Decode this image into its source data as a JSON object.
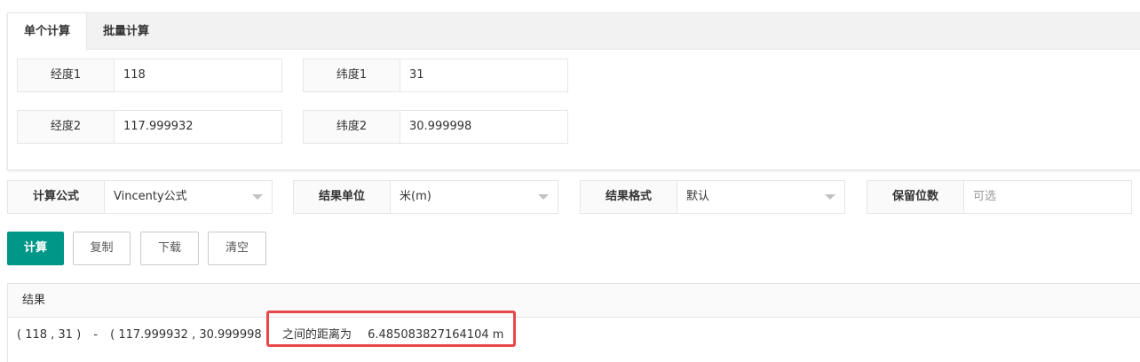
{
  "tabs": [
    "单个计算",
    "批量计算"
  ],
  "inputs": {
    "lon1": {
      "label": "经度1",
      "value": "118"
    },
    "lat1": {
      "label": "纬度1",
      "value": "31"
    },
    "lon2": {
      "label": "经度2",
      "value": "117.999932"
    },
    "lat2": {
      "label": "纬度2",
      "value": "30.999998"
    }
  },
  "options": {
    "formula": {
      "label": "计算公式",
      "value": "Vincenty公式"
    },
    "unit": {
      "label": "结果单位",
      "value": "米(m)"
    },
    "format": {
      "label": "结果格式",
      "value": "默认"
    },
    "decimals": {
      "label": "保留位数",
      "placeholder": "可选"
    }
  },
  "buttons": {
    "calculate": "计算",
    "copy": "复制",
    "download": "下载",
    "clear": "清空"
  },
  "result": {
    "title": "结果",
    "point1": "( 118 , 31 )",
    "separator": "-",
    "point2": "( 117.999932 , 30.999998 )",
    "text": "之间的距离为",
    "distance": "6.485083827164104 m"
  },
  "colors": {
    "primary": "#009688",
    "highlight_border": "#e8474a"
  }
}
